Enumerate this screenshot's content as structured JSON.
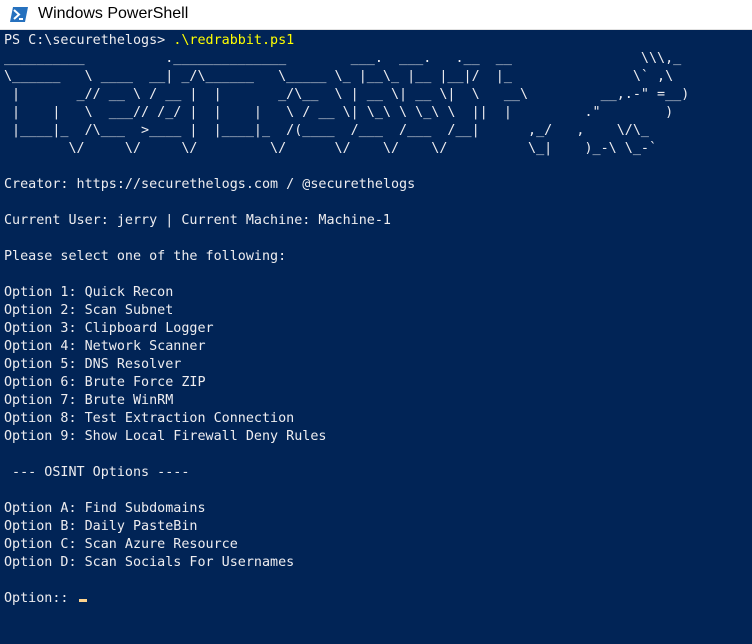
{
  "window": {
    "title": "Windows PowerShell",
    "colors": {
      "background": "#012456",
      "text": "#eeedf0",
      "command": "#ffff00",
      "cursor": "#fed38d"
    }
  },
  "console": {
    "prompt": "PS C:\\securethelogs> ",
    "command": ".\\redrabbit.ps1",
    "banner": [
      "__________          .______________        ___.  ___.   .__  __                \\\\\\,_",
      "\\______   \\ ____  __| _/\\______   \\_____ \\_ |__\\_ |__ |__|/  |_               \\` ,\\",
      " |       _// __ \\ / __ |  |       _/\\__  \\ | __ \\| __ \\|  \\   __\\         __,.-\" =__)",
      " |    |   \\  ___// /_/ |  |    |   \\ / __ \\| \\_\\ \\ \\_\\ \\  ||  |         .\"        )",
      " |____|_  /\\___  >____ |  |____|_  /(____  /___  /___  /__|      ,_/   ,    \\/\\_",
      "        \\/     \\/     \\/         \\/      \\/    \\/    \\/          \\_|    )_-\\ \\_-`"
    ],
    "creator": "Creator: https://securethelogs.com / @securethelogs",
    "current_user": "Current User: jerry | Current Machine: Machine-1",
    "select_prompt": "Please select one of the following:",
    "options": [
      "Option 1: Quick Recon",
      "Option 2: Scan Subnet",
      "Option 3: Clipboard Logger",
      "Option 4: Network Scanner",
      "Option 5: DNS Resolver",
      "Option 6: Brute Force ZIP",
      "Option 7: Brute WinRM",
      "Option 8: Test Extraction Connection",
      "Option 9: Show Local Firewall Deny Rules"
    ],
    "osint_header": " --- OSINT Options ----",
    "osint_options": [
      "Option A: Find Subdomains",
      "Option B: Daily PasteBin",
      "Option C: Scan Azure Resource",
      "Option D: Scan Socials For Usernames"
    ],
    "input_prompt": "Option:: "
  }
}
